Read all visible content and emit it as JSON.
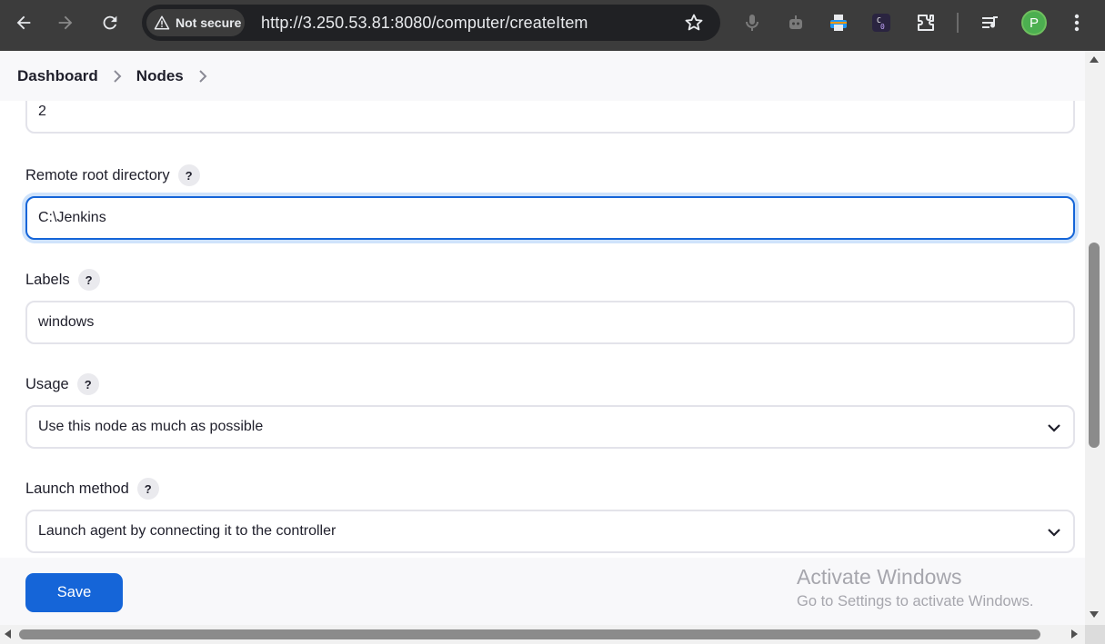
{
  "browser": {
    "security_label": "Not secure",
    "url": "http://3.250.53.81:8080/computer/createItem",
    "profile_initial": "P"
  },
  "breadcrumb": {
    "items": [
      "Dashboard",
      "Nodes"
    ]
  },
  "form": {
    "executors_value": "2",
    "remote_root": {
      "label": "Remote root directory",
      "value": "C:\\Jenkins"
    },
    "labels": {
      "label": "Labels",
      "value": "windows"
    },
    "usage": {
      "label": "Usage",
      "selected": "Use this node as much as possible"
    },
    "launch_method": {
      "label": "Launch method",
      "selected": "Launch agent by connecting it to the controller"
    },
    "help_glyph": "?"
  },
  "actions": {
    "save_label": "Save"
  },
  "watermark": {
    "title": "Activate Windows",
    "subtitle": "Go to Settings to activate Windows."
  },
  "colors": {
    "accent": "#1565d8",
    "chrome": "#3c3c3c",
    "avatar": "#4caf50"
  }
}
